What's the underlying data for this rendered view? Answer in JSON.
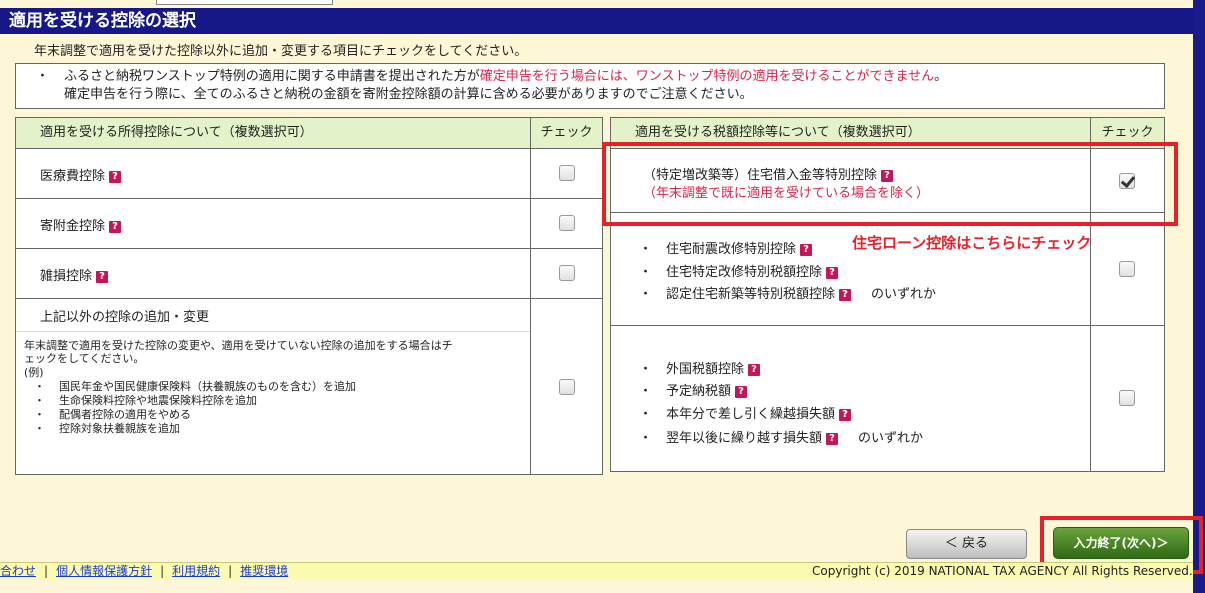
{
  "header": {
    "title": "適用を受ける控除の選択"
  },
  "instruction": "年末調整で適用を受けた控除以外に追加・変更する項目にチェックをしてください。",
  "notice": {
    "bullet": "・",
    "line1_a": "ふるさと納税ワンストップ特例の適用に関する申請書を提出された方が",
    "line1_b": "確定申告を行う場合には、ワンストップ特例の適用を受けることができません",
    "line1_c": "。",
    "line2": "確定申告を行う際に、全てのふるさと納税の金額を寄附金控除額の計算に含める必要がありますのでご注意ください。"
  },
  "left_table": {
    "header": "適用を受ける所得控除について（複数選択可）",
    "check_header": "チェック",
    "rows": [
      {
        "label": "医療費控除",
        "checked": false
      },
      {
        "label": "寄附金控除",
        "checked": false
      },
      {
        "label": "雑損控除",
        "checked": false
      }
    ],
    "other": {
      "label": "上記以外の控除の追加・変更",
      "desc1": "年末調整で適用を受けた控除の変更や、適用を受けていない控除の追加をする場合はチ",
      "desc2": "ェックをしてください。",
      "example": "(例)",
      "examples": [
        "国民年金や国民健康保険料（扶養親族のものを含む）を追加",
        "生命保険料控除や地震保険料控除を追加",
        "配偶者控除の適用をやめる",
        "控除対象扶養親族を追加"
      ],
      "checked": false
    }
  },
  "right_table": {
    "header": "適用を受ける税額控除等について（複数選択可）",
    "check_header": "チェック",
    "row1": {
      "label": "（特定増改築等）住宅借入金等特別控除",
      "sub": "（年末調整で既に適用を受けている場合を除く）",
      "checked": true
    },
    "row2": {
      "items": [
        "住宅耐震改修特別控除",
        "住宅特定改修特別税額控除",
        "認定住宅新築等特別税額控除"
      ],
      "suffix": "のいずれか",
      "checked": false
    },
    "row3": {
      "items": [
        "外国税額控除",
        "予定納税額",
        "本年分で差し引く繰越損失額",
        "翌年以後に繰り越す損失額"
      ],
      "suffix": "のいずれか",
      "checked": false
    }
  },
  "annotation": "住宅ローン控除はこちらにチェック",
  "help_mark": "?",
  "bullet": "・",
  "buttons": {
    "back": "＜ 戻る",
    "next": "入力終了(次へ)＞"
  },
  "footer": {
    "links": [
      "合わせ",
      "個人情報保護方針",
      "利用規約",
      "推奨環境"
    ],
    "separator": "|",
    "copyright": "Copyright (c) 2019 NATIONAL TAX AGENCY All Rights Reserved."
  },
  "colors": {
    "header_bg": "#17178a",
    "accent_red": "#e8202a",
    "notice_red": "#d9254a",
    "next_button": "#4a8a26"
  }
}
